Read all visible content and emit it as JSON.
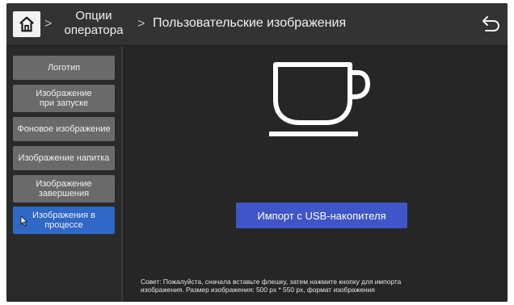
{
  "header": {
    "home_icon": "home-icon",
    "crumb_operator_line1": "Опции",
    "crumb_operator_line2": "оператора",
    "separator": ">",
    "title": "Пользовательские изображения",
    "back_icon": "back-arrow-icon"
  },
  "sidebar": {
    "items": [
      {
        "label": "Логотип",
        "active": false
      },
      {
        "label_line1": "Изображение",
        "label_line2": "при запуске",
        "active": false
      },
      {
        "label": "Фоновое изображение",
        "active": false
      },
      {
        "label": "Изображение напитка",
        "active": false
      },
      {
        "label_line1": "Изображение",
        "label_line2": "завершения",
        "active": false
      },
      {
        "label_line1": "Изображения в",
        "label_line2": "процессе",
        "active": true
      }
    ],
    "active_color": "#2f68c6"
  },
  "main": {
    "preview_icon": "coffee-cup-icon",
    "import_button": "Импорт с USB-накопителя",
    "import_color": "#3f55c8",
    "tip_line1": "Совет: Пожалуйста, сначала вставьте флешку, затем нажмите кнопку для импорта",
    "tip_line2": "изображения. Размер изображения: 500 px * 550 px, формат изображения"
  }
}
